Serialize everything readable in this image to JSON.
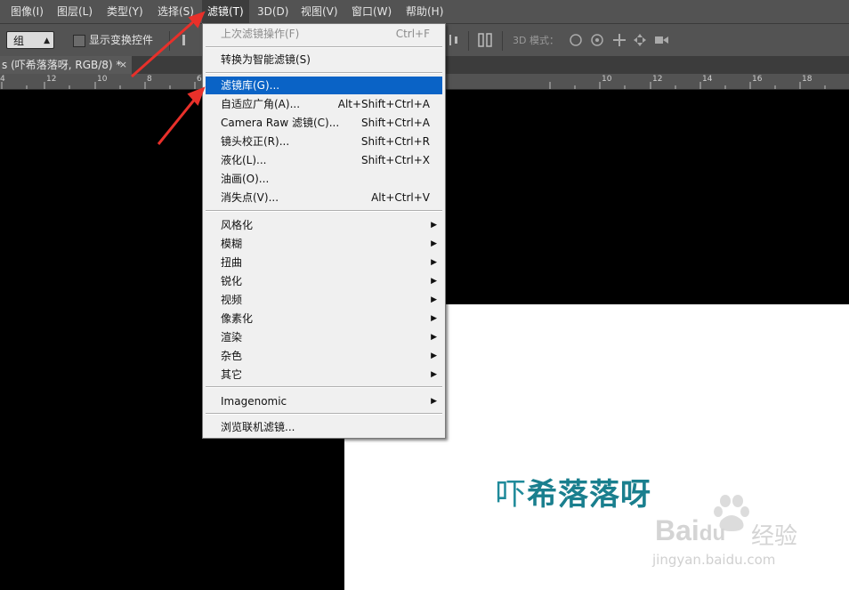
{
  "menubar": {
    "items": [
      {
        "label": "图像(I)"
      },
      {
        "label": "图层(L)"
      },
      {
        "label": "类型(Y)"
      },
      {
        "label": "选择(S)"
      },
      {
        "label": "滤镜(T)"
      },
      {
        "label": "3D(D)"
      },
      {
        "label": "视图(V)"
      },
      {
        "label": "窗口(W)"
      },
      {
        "label": "帮助(H)"
      }
    ]
  },
  "options": {
    "group_select": "组",
    "show_transform_label": "显示变换控件",
    "mode_3d_label": "3D 模式："
  },
  "document_tab": {
    "title": "s (吓希落落呀, RGB/8) *",
    "close": "×"
  },
  "ruler": {
    "ticks": [
      "4",
      "12",
      "10",
      "8",
      "6",
      "10",
      "12",
      "14",
      "16",
      "18"
    ]
  },
  "filter_menu": {
    "items": [
      {
        "label": "上次滤镜操作(F)",
        "shortcut": "Ctrl+F",
        "disabled": true
      },
      {
        "label": "转换为智能滤镜(S)",
        "shortcut": ""
      },
      {
        "label": "滤镜库(G)...",
        "shortcut": "",
        "highlighted": true
      },
      {
        "label": "自适应广角(A)...",
        "shortcut": "Alt+Shift+Ctrl+A"
      },
      {
        "label": "Camera Raw 滤镜(C)...",
        "shortcut": "Shift+Ctrl+A"
      },
      {
        "label": "镜头校正(R)...",
        "shortcut": "Shift+Ctrl+R"
      },
      {
        "label": "液化(L)...",
        "shortcut": "Shift+Ctrl+X"
      },
      {
        "label": "油画(O)...",
        "shortcut": ""
      },
      {
        "label": "消失点(V)...",
        "shortcut": "Alt+Ctrl+V"
      },
      {
        "label": "风格化",
        "submenu": true
      },
      {
        "label": "模糊",
        "submenu": true
      },
      {
        "label": "扭曲",
        "submenu": true
      },
      {
        "label": "锐化",
        "submenu": true
      },
      {
        "label": "视频",
        "submenu": true
      },
      {
        "label": "像素化",
        "submenu": true
      },
      {
        "label": "渲染",
        "submenu": true
      },
      {
        "label": "杂色",
        "submenu": true
      },
      {
        "label": "其它",
        "submenu": true
      },
      {
        "label": "Imagenomic",
        "submenu": true
      },
      {
        "label": "浏览联机滤镜..."
      }
    ],
    "submenu_arrow": "▶"
  },
  "canvas_text": {
    "thin_char": "吓",
    "bold_chars": "希落落呀"
  },
  "watermark": {
    "brand": "Bai",
    "brand2": "du",
    "suffix": "经验",
    "url": "jingyan.baidu.com"
  },
  "colors": {
    "highlight": "#0a63c6",
    "arrow_red": "#e8302a",
    "title_teal": "#1f8a9a"
  }
}
